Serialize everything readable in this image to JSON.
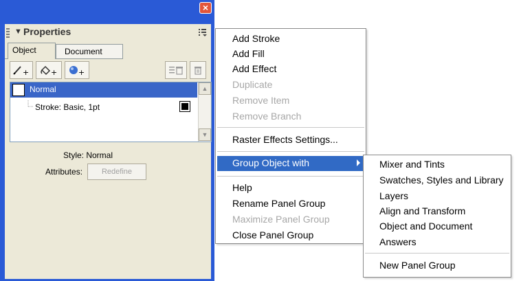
{
  "panel": {
    "title": "Properties",
    "tabs": [
      "Object",
      "Document"
    ],
    "toolbar": {
      "add_stroke_icon": "pencil-plus-icon",
      "add_fill_icon": "bucket-plus-icon",
      "add_effect_icon": "sphere-plus-icon",
      "duplicate_icon": "duplicate-icon",
      "trash_icon": "trash-icon"
    },
    "list": {
      "items": [
        {
          "label": "Normal",
          "selected": true
        },
        {
          "label": "Stroke: Basic, 1pt",
          "selected": false
        }
      ]
    },
    "style_text": "Style: Normal",
    "attributes_label": "Attributes:",
    "redefine_label": "Redefine"
  },
  "context_menu": {
    "items": [
      {
        "label": "Add Stroke",
        "enabled": true
      },
      {
        "label": "Add Fill",
        "enabled": true
      },
      {
        "label": "Add Effect",
        "enabled": true
      },
      {
        "label": "Duplicate",
        "enabled": false
      },
      {
        "label": "Remove Item",
        "enabled": false
      },
      {
        "label": "Remove Branch",
        "enabled": false
      },
      {
        "label": "Raster Effects Settings...",
        "enabled": true
      },
      {
        "label": "Group Object with",
        "enabled": true,
        "highlighted": true
      },
      {
        "label": "Help",
        "enabled": true
      },
      {
        "label": "Rename Panel Group",
        "enabled": true
      },
      {
        "label": "Maximize Panel Group",
        "enabled": false
      },
      {
        "label": "Close Panel Group",
        "enabled": true
      }
    ]
  },
  "submenu": {
    "items": [
      {
        "label": "Mixer and Tints"
      },
      {
        "label": "Swatches, Styles and Library"
      },
      {
        "label": "Layers"
      },
      {
        "label": "Align and Transform"
      },
      {
        "label": "Object and Document"
      },
      {
        "label": "Answers"
      },
      {
        "label": "New Panel Group"
      }
    ]
  },
  "colors": {
    "window_frame": "#2a5ad6",
    "panel_bg": "#ece9d8",
    "selection": "#3a66c8",
    "menu_highlight": "#316ac5",
    "close_button": "#e2563a"
  }
}
